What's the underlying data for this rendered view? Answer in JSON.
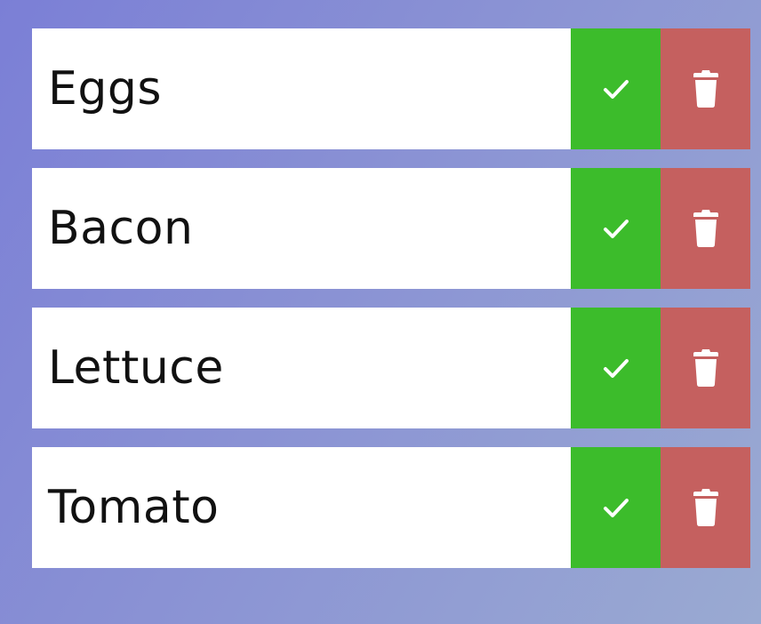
{
  "colors": {
    "complete": "#3cbc2b",
    "trash": "#c5605f",
    "item_bg": "#ffffff",
    "text": "#111111"
  },
  "todos": [
    {
      "text": "Eggs",
      "complete_icon": "check-icon",
      "trash_icon": "trash-icon"
    },
    {
      "text": "Bacon",
      "complete_icon": "check-icon",
      "trash_icon": "trash-icon"
    },
    {
      "text": "Lettuce",
      "complete_icon": "check-icon",
      "trash_icon": "trash-icon"
    },
    {
      "text": "Tomato",
      "complete_icon": "check-icon",
      "trash_icon": "trash-icon"
    }
  ]
}
